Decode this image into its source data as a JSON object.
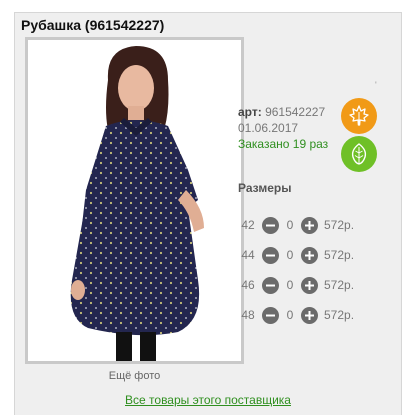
{
  "product": {
    "title": "Рубашка (961542227)",
    "more_photo_label": "Ещё фото",
    "dot_mark": "'",
    "article_label": "арт:",
    "article_value": "961542227",
    "date": "01.06.2017",
    "ordered": "Заказано 19 раз",
    "sizes_title": "Размеры",
    "sizes": [
      {
        "size": "42",
        "qty": "0",
        "price": "572р."
      },
      {
        "size": "44",
        "qty": "0",
        "price": "572р."
      },
      {
        "size": "46",
        "qty": "0",
        "price": "572р."
      },
      {
        "size": "48",
        "qty": "0",
        "price": "572р."
      }
    ],
    "supplier_link": "Все товары этого поставщика"
  },
  "badges": [
    {
      "icon": "maple-leaf-icon",
      "color": "#f19a17"
    },
    {
      "icon": "leaf-icon",
      "color": "#6fc027"
    }
  ],
  "colors": {
    "card_bg": "#efefef",
    "link_green": "#2f8f1f",
    "circle_gray": "#6b6b6b"
  }
}
